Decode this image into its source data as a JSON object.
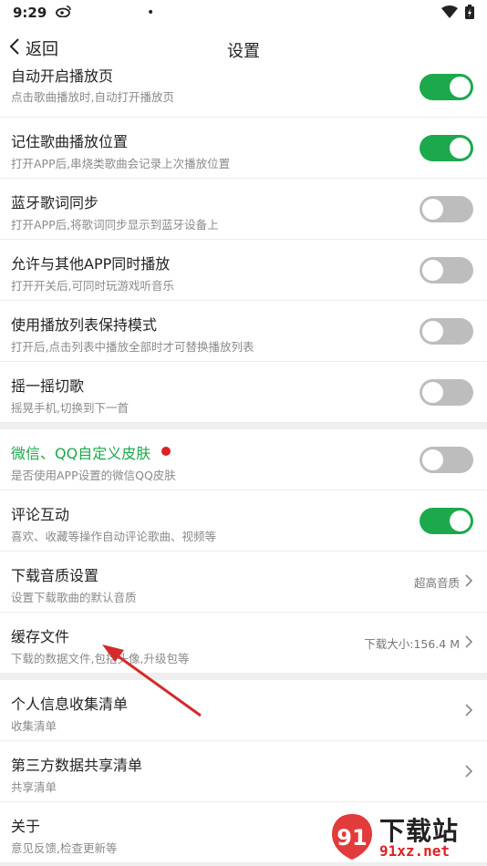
{
  "status_bar": {
    "time": "9:29",
    "weibo_icon": "weibo-icon",
    "dot": "•"
  },
  "nav": {
    "back_label": "返回",
    "title": "设置"
  },
  "settings": [
    {
      "title": "自动开启播放页",
      "subtitle": "点击歌曲播放时,自动打开播放页",
      "toggle": true
    },
    {
      "title": "记住歌曲播放位置",
      "subtitle": "打开APP后,串烧类歌曲会记录上次播放位置",
      "toggle": true
    },
    {
      "title": "蓝牙歌词同步",
      "subtitle": "打开APP后,将歌词同步显示到蓝牙设备上",
      "toggle": false
    },
    {
      "title": "允许与其他APP同时播放",
      "subtitle": "打开开关后,可同时玩游戏听音乐",
      "toggle": false
    },
    {
      "title": "使用播放列表保持模式",
      "subtitle": "打开后,点击列表中播放全部时才可替换播放列表",
      "toggle": false
    },
    {
      "title": "摇一摇切歌",
      "subtitle": "摇晃手机,切换到下一首",
      "toggle": false
    }
  ],
  "settings2": [
    {
      "title": "微信、QQ自定义皮肤",
      "subtitle": "是否使用APP设置的微信QQ皮肤",
      "toggle": false
    },
    {
      "title": "评论互动",
      "subtitle": "喜欢、收藏等操作自动评论歌曲、视频等",
      "toggle": true
    },
    {
      "title": "下载音质设置",
      "subtitle": "设置下载歌曲的默认音质",
      "value": "超高音质"
    },
    {
      "title": "缓存文件",
      "subtitle": "下载的数据文件,包括头像,升级包等",
      "value": "下载大小:156.4 M"
    }
  ],
  "settings3": [
    {
      "title": "个人信息收集清单",
      "subtitle": "收集清单"
    },
    {
      "title": "第三方数据共享清单",
      "subtitle": "共享清单"
    },
    {
      "title": "关于",
      "subtitle": "意见反馈,检查更新等"
    }
  ],
  "watermark": {
    "big": "下载站",
    "small": "91xz.net"
  },
  "colors": {
    "accent_green": "#1ba94c",
    "toggle_off": "#bdbdbd",
    "arrow_red": "#d42a2a"
  }
}
